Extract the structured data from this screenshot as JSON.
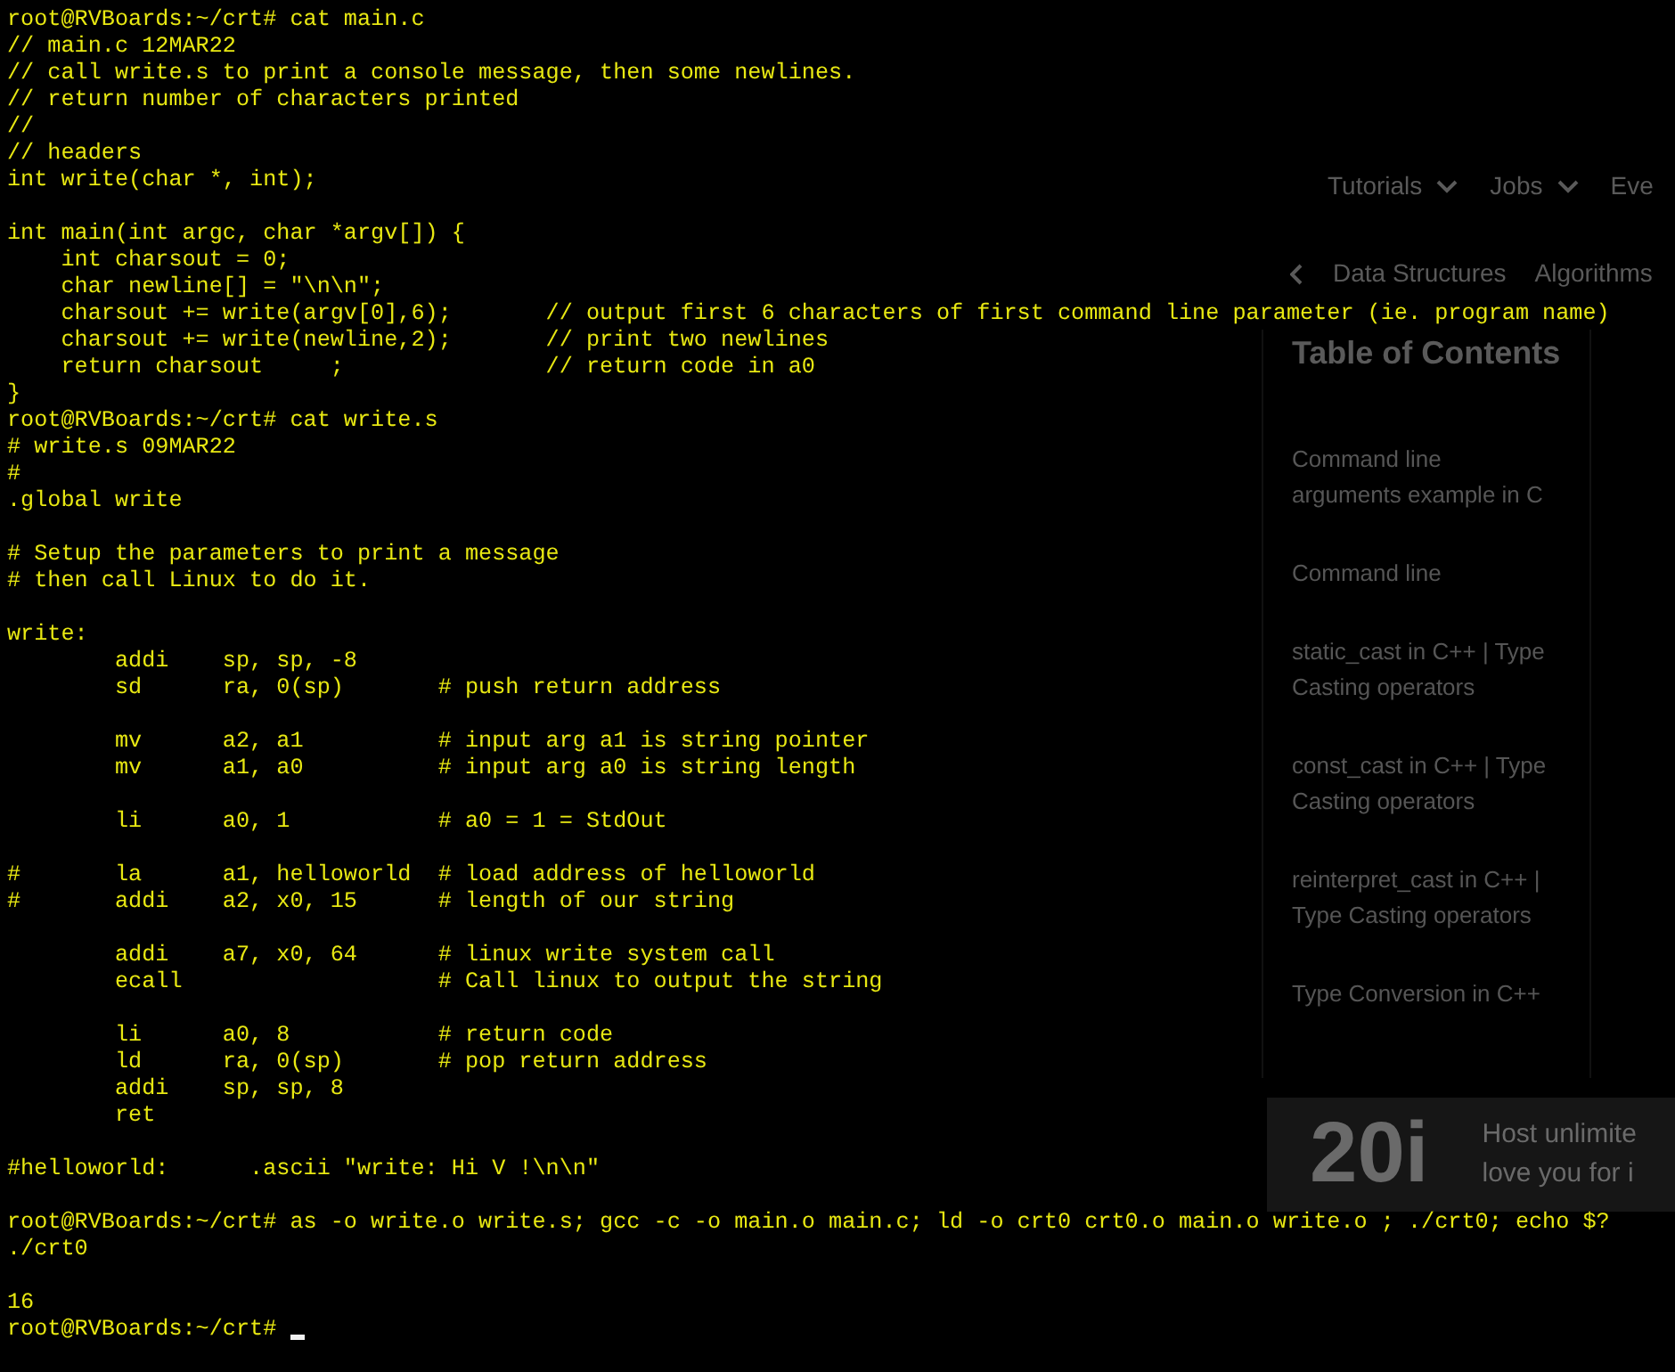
{
  "background_page": {
    "nav": [
      {
        "label": "Tutorials"
      },
      {
        "label": "Jobs"
      },
      {
        "label": "Eve"
      }
    ],
    "breadcrumb": [
      "Data Structures",
      "Algorithms"
    ],
    "toc": {
      "title": "Table of Contents",
      "items": [
        [
          "Command line",
          "arguments example in C"
        ],
        [
          "Command line"
        ],
        [
          "static_cast in C++ | Type",
          "Casting operators"
        ],
        [
          "const_cast in C++ | Type",
          "Casting operators"
        ],
        [
          "reinterpret_cast in C++ |",
          "Type Casting operators"
        ],
        [
          "Type Conversion in C++"
        ]
      ]
    },
    "ad": {
      "logo": "20i",
      "lines": [
        "Host unlimite",
        "love you for i"
      ]
    }
  },
  "terminal": {
    "cursor_visible": true,
    "blocks": [
      [
        "root@RVBoards:~/crt# cat main.c",
        "// main.c 12MAR22",
        "// call write.s to print a console message, then some newlines.",
        "// return number of characters printed",
        "//",
        "// headers",
        "int write(char *, int);"
      ],
      [
        "int main(int argc, char *argv[]) {",
        "    int charsout = 0;",
        "    char newline[] = \"\\n\\n\";",
        "    charsout += write(argv[0],6);       // output first 6 characters of first command line parameter (ie. program name)",
        "    charsout += write(newline,2);       // print two newlines",
        "    return charsout     ;               // return code in a0",
        "}",
        "root@RVBoards:~/crt# cat write.s",
        "# write.s 09MAR22",
        "#",
        ".global write"
      ],
      [
        "# Setup the parameters to print a message",
        "# then call Linux to do it."
      ],
      [
        "write:",
        "        addi    sp, sp, -8",
        "        sd      ra, 0(sp)       # push return address"
      ],
      [
        "        mv      a2, a1          # input arg a1 is string pointer",
        "        mv      a1, a0          # input arg a0 is string length"
      ],
      [
        "        li      a0, 1           # a0 = 1 = StdOut"
      ],
      [
        "#       la      a1, helloworld  # load address of helloworld",
        "#       addi    a2, x0, 15      # length of our string"
      ],
      [
        "        addi    a7, x0, 64      # linux write system call",
        "        ecall                   # Call linux to output the string"
      ],
      [
        "        li      a0, 8           # return code",
        "        ld      ra, 0(sp)       # pop return address",
        "        addi    sp, sp, 8",
        "        ret"
      ],
      [
        "#helloworld:      .ascii \"write: Hi V !\\n\\n\""
      ],
      [
        "root@RVBoards:~/crt# as -o write.o write.s; gcc -c -o main.o main.c; ld -o crt0 crt0.o main.o write.o ; ./crt0; echo $?",
        "./crt0"
      ],
      [
        "16",
        "root@RVBoards:~/crt# "
      ]
    ]
  }
}
